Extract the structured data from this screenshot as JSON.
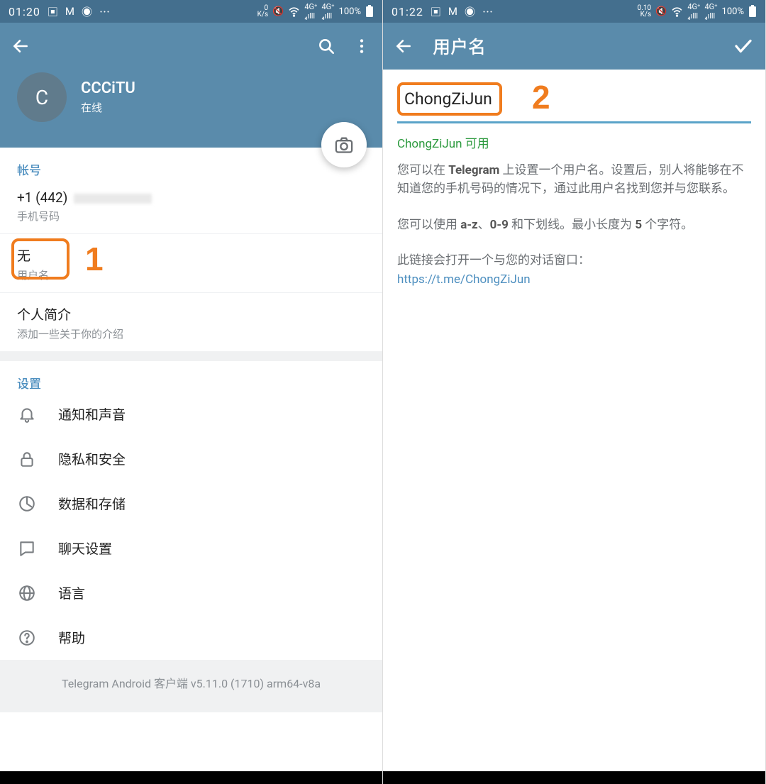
{
  "left": {
    "statusbar": {
      "time": "01:20",
      "speed": "0\nK/s",
      "battery": "100%"
    },
    "header": {},
    "profile": {
      "avatar_letter": "C",
      "name": "CCCiTU",
      "status": "在线"
    },
    "account": {
      "section_title": "帐号",
      "phone_value": "+1 (442)",
      "phone_label": "手机号码",
      "username_value": "无",
      "username_label": "用户名",
      "bio_value": "个人简介",
      "bio_label": "添加一些关于你的介绍"
    },
    "settings": {
      "section_title": "设置",
      "items": [
        {
          "label": "通知和声音"
        },
        {
          "label": "隐私和安全"
        },
        {
          "label": "数据和存储"
        },
        {
          "label": "聊天设置"
        },
        {
          "label": "语言"
        },
        {
          "label": "帮助"
        }
      ]
    },
    "footer": "Telegram Android 客户端 v5.11.0 (1710) arm64-v8a",
    "annotation1": "1"
  },
  "right": {
    "statusbar": {
      "time": "01:22",
      "speed": "0.10\nK/s",
      "battery": "100%"
    },
    "header": {
      "title": "用户名"
    },
    "input_value": "ChongZiJun",
    "availability": "ChongZiJun 可用",
    "desc1_a": "您可以在 ",
    "desc1_b": "Telegram",
    "desc1_c": " 上设置一个用户名。设置后，别人将能够在不知道您的手机号码的情况下，通过此用户名找到您并与您联系。",
    "desc2_a": "您可以使用 ",
    "desc2_b": "a-z",
    "desc2_c": "、",
    "desc2_d": "0-9",
    "desc2_e": " 和下划线。最小长度为 ",
    "desc2_f": "5",
    "desc2_g": " 个字符。",
    "desc3": "此链接会打开一个与您的对话窗口：",
    "link": "https://t.me/ChongZiJun",
    "annotation2": "2"
  }
}
